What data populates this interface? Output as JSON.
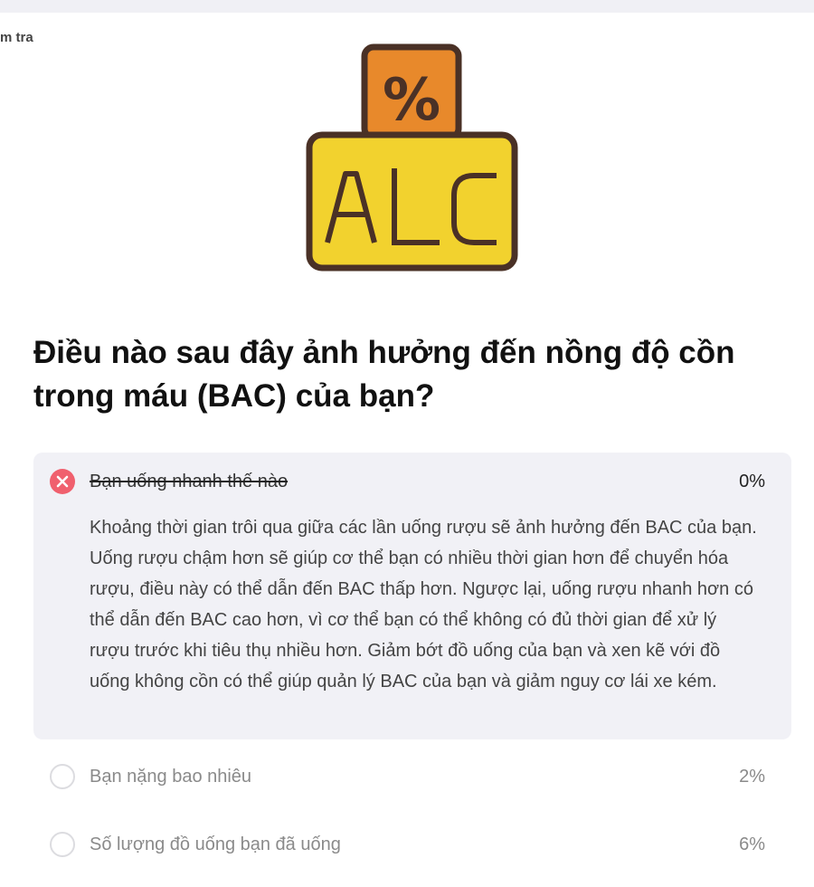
{
  "breadcrumb": {
    "text": "m tra"
  },
  "hero": {
    "icon": "alc-percent-icon",
    "tag_text": "%",
    "sign_text": "ALC",
    "colors": {
      "orange": "#E8892B",
      "yellow": "#F2D22E",
      "outline": "#4A3126"
    }
  },
  "question": {
    "text": "Điều nào sau đây ảnh hưởng đến nồng độ cồn trong máu (BAC) của bạn?"
  },
  "options": [
    {
      "label": "Bạn uống nhanh thế nào",
      "percent": "0%",
      "state": "incorrect-selected",
      "icon": "x-circle-icon",
      "explanation": "Khoảng thời gian trôi qua giữa các lần uống rượu sẽ ảnh hưởng đến BAC của bạn. Uống rượu chậm hơn sẽ giúp cơ thể bạn có nhiều thời gian hơn để chuyển hóa rượu, điều này có thể dẫn đến BAC thấp hơn. Ngược lại, uống rượu nhanh hơn có thể dẫn đến BAC cao hơn, vì cơ thể bạn có thể không có đủ thời gian để xử lý rượu trước khi tiêu thụ nhiều hơn. Giảm bớt đồ uống của bạn và xen kẽ với đồ uống không cồn có thể giúp quản lý BAC của bạn và giảm nguy cơ lái xe kém."
    },
    {
      "label": "Bạn nặng bao nhiêu",
      "percent": "2%",
      "state": "unselected",
      "icon": "radio-circle-icon"
    },
    {
      "label": "Số lượng đồ uống bạn đã uống",
      "percent": "6%",
      "state": "unselected",
      "icon": "radio-circle-icon"
    }
  ],
  "colors": {
    "incorrect": "#F0606E",
    "card_bg": "#F1F1F6",
    "muted_text": "#8A8A8A"
  }
}
